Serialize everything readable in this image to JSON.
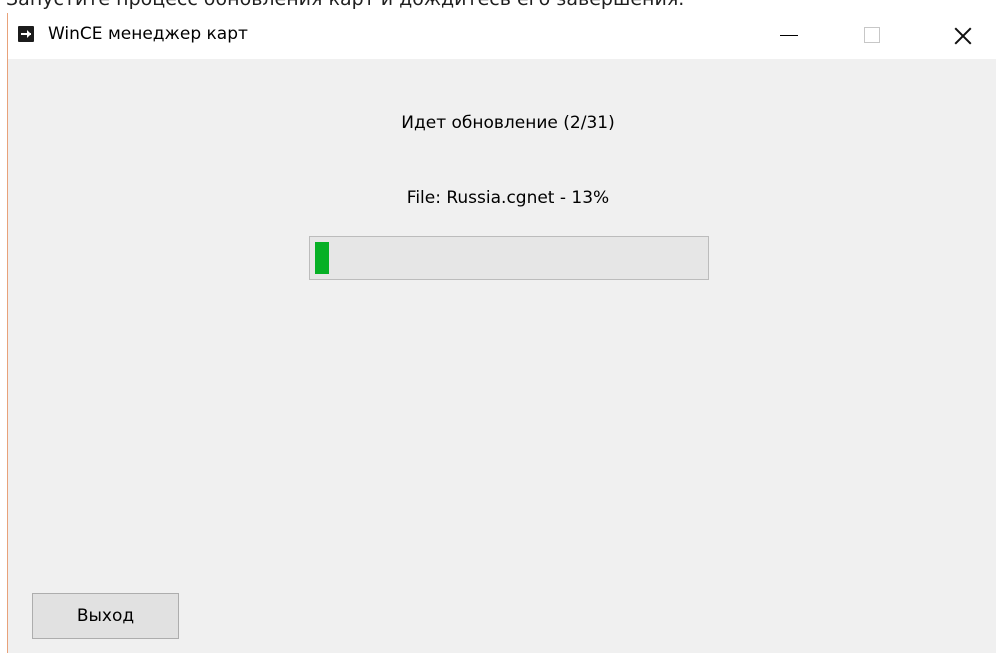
{
  "background": {
    "caption": "Запустите процесс обновления карт и дождитесь его завершения."
  },
  "window": {
    "title": "WinCE менеджер карт",
    "icon": "app-icon",
    "controls": {
      "minimize": "minimize-icon",
      "maximize": "maximize-icon",
      "close": "close-icon"
    }
  },
  "content": {
    "status": "Идет обновление (2/31)",
    "file_status": "File: Russia.cgnet - 13%",
    "progress_fraction": 0.035,
    "exit_button": "Выход"
  },
  "colors": {
    "progress_fill": "#06b025",
    "window_background": "#f0f0f0",
    "titlebar_background": "#ffffff"
  }
}
